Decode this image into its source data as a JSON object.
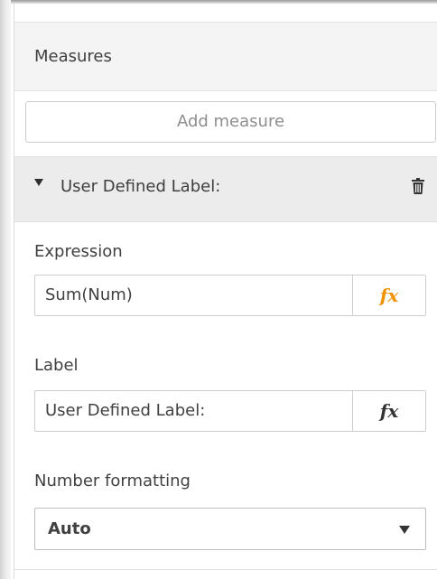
{
  "measures_section": {
    "title": "Measures",
    "add_button_label": "Add measure"
  },
  "measure_item": {
    "title": "User Defined Label:",
    "expanded": true,
    "expression": {
      "label": "Expression",
      "value": "Sum(Num)",
      "fx_icon": "fx-icon",
      "fx_color": "#f29100"
    },
    "label_field": {
      "label": "Label",
      "value": "User Defined Label:",
      "fx_icon": "fx-icon",
      "fx_color": "#333333"
    },
    "number_formatting": {
      "label": "Number formatting",
      "selected": "Auto"
    }
  },
  "icons": {
    "expand": "caret-down-icon",
    "delete": "trash-icon",
    "dropdown": "chevron-down-icon"
  }
}
